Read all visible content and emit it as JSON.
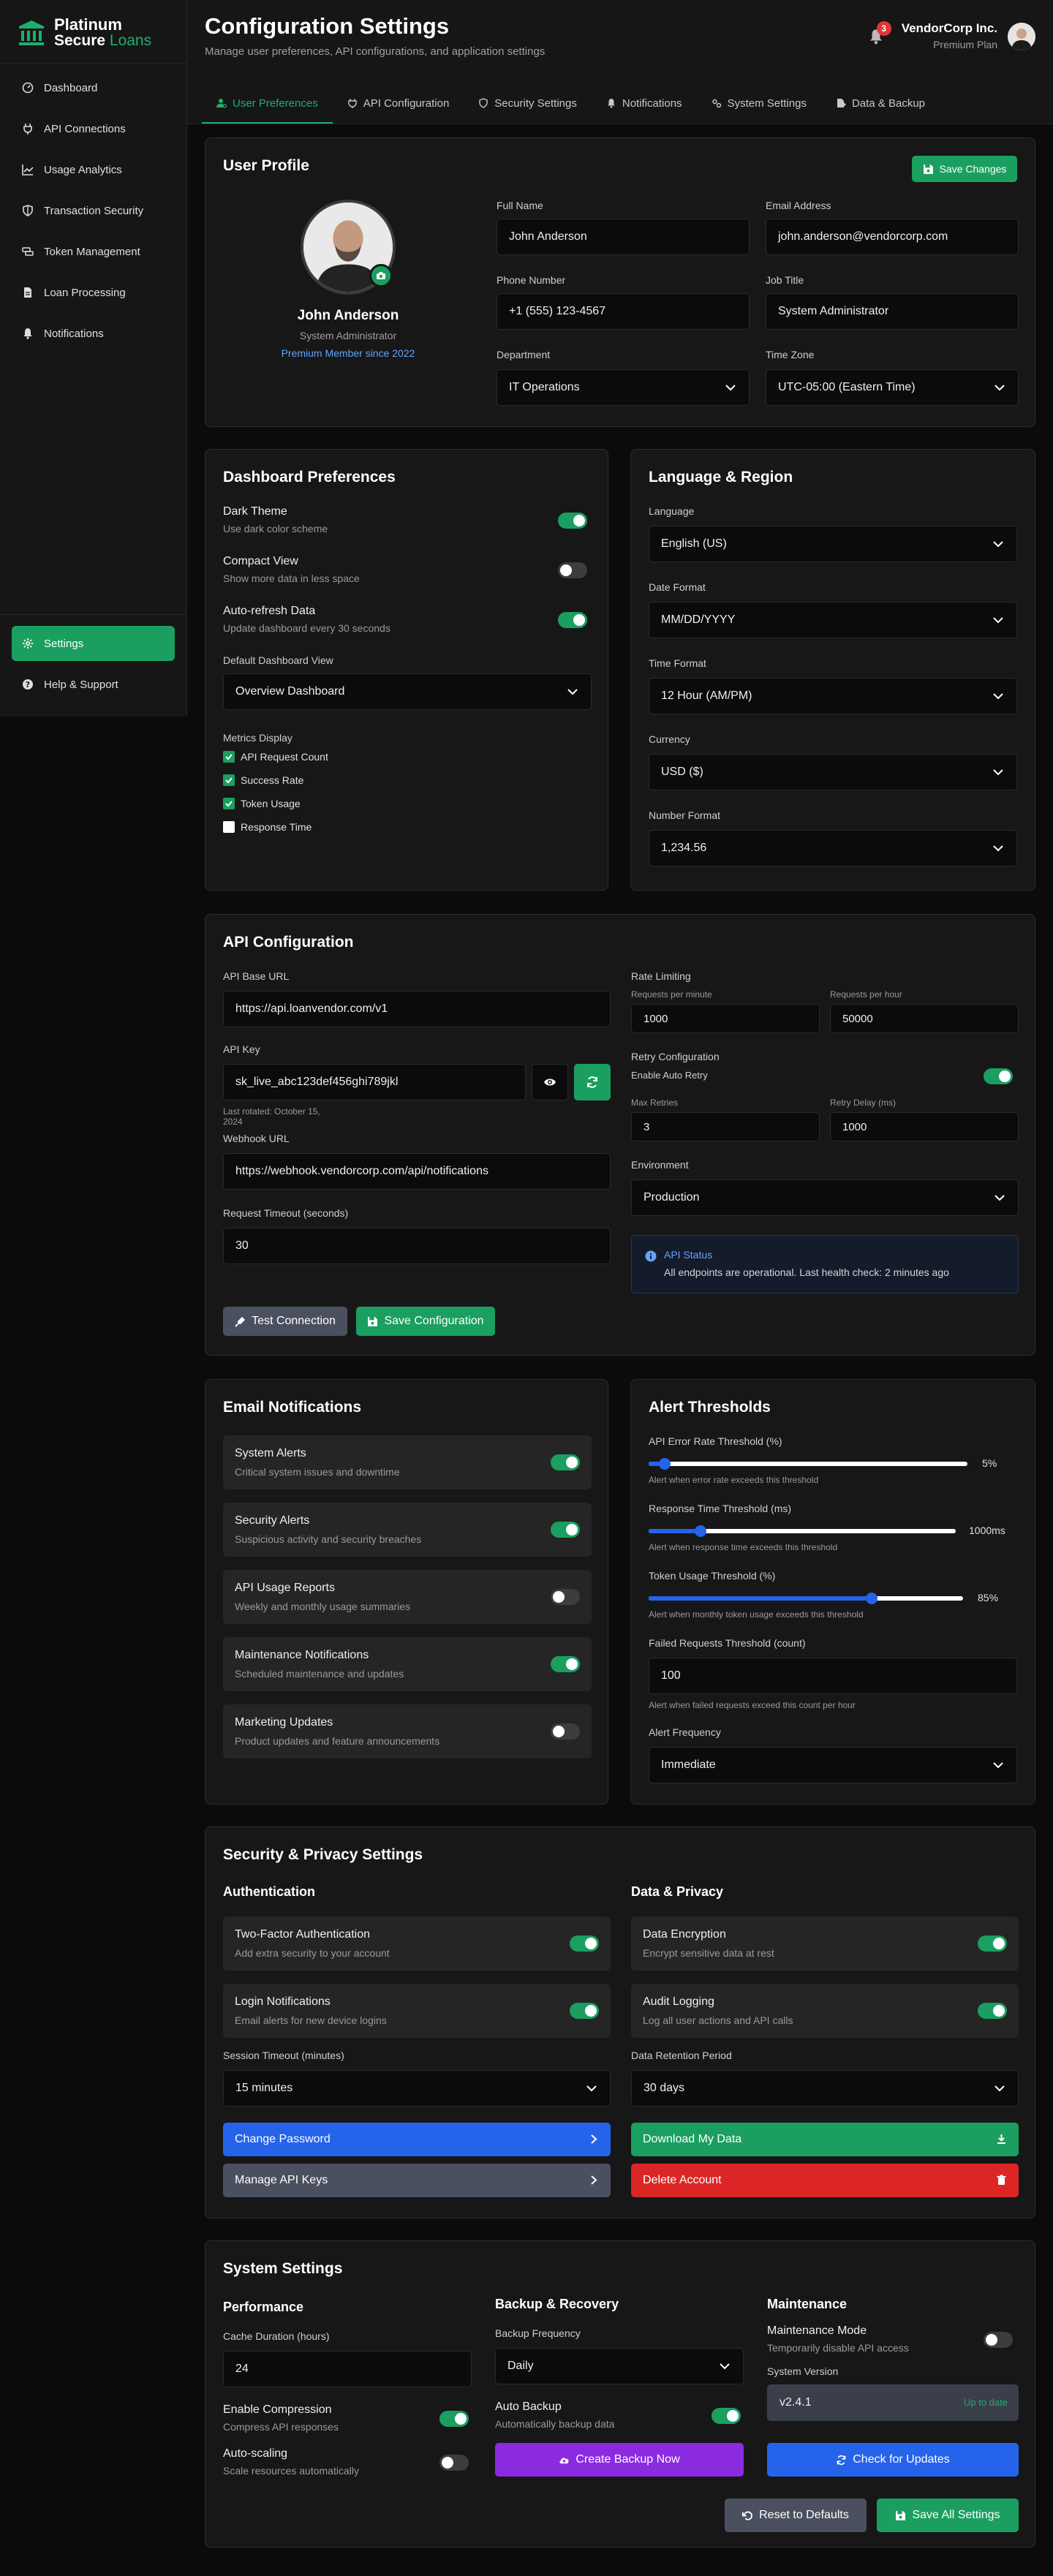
{
  "brand": {
    "line1": "Platinum",
    "line2a": "Secure",
    "line2b": "Loans"
  },
  "sidebar": {
    "items": [
      {
        "label": "Dashboard",
        "icon": "dashboard-icon"
      },
      {
        "label": "API Connections",
        "icon": "plug-icon"
      },
      {
        "label": "Usage Analytics",
        "icon": "chart-line-icon"
      },
      {
        "label": "Transaction Security",
        "icon": "shield-icon"
      },
      {
        "label": "Token Management",
        "icon": "coins-icon"
      },
      {
        "label": "Loan Processing",
        "icon": "file-icon"
      },
      {
        "label": "Notifications",
        "icon": "bell-icon"
      }
    ],
    "settings_label": "Settings",
    "help_label": "Help & Support"
  },
  "header": {
    "title": "Configuration Settings",
    "subtitle": "Manage user preferences, API configurations, and application settings",
    "notification_count": "3",
    "org_name": "VendorCorp Inc.",
    "org_plan": "Premium Plan"
  },
  "tabs": [
    "User Preferences",
    "API Configuration",
    "Security Settings",
    "Notifications",
    "System Settings",
    "Data & Backup"
  ],
  "profile": {
    "title": "User Profile",
    "save_label": "Save Changes",
    "name": "John Anderson",
    "role": "System Administrator",
    "member": "Premium Member since 2022",
    "full_name_label": "Full Name",
    "full_name": "John Anderson",
    "email_label": "Email Address",
    "email": "john.anderson@vendorcorp.com",
    "phone_label": "Phone Number",
    "phone": "+1 (555) 123-4567",
    "job_label": "Job Title",
    "job": "System Administrator",
    "dept_label": "Department",
    "dept": "IT Operations",
    "tz_label": "Time Zone",
    "tz": "UTC-05:00 (Eastern Time)"
  },
  "dashboard": {
    "title": "Dashboard Preferences",
    "dark_title": "Dark Theme",
    "dark_desc": "Use dark color scheme",
    "dark_on": true,
    "compact_title": "Compact View",
    "compact_desc": "Show more data in less space",
    "compact_on": false,
    "refresh_title": "Auto-refresh Data",
    "refresh_desc": "Update dashboard every 30 seconds",
    "refresh_on": true,
    "default_view_label": "Default Dashboard View",
    "default_view": "Overview Dashboard",
    "metrics_label": "Metrics Display",
    "metrics": [
      {
        "label": "API Request Count",
        "checked": true
      },
      {
        "label": "Success Rate",
        "checked": true
      },
      {
        "label": "Token Usage",
        "checked": true
      },
      {
        "label": "Response Time",
        "checked": false
      }
    ]
  },
  "language": {
    "title": "Language & Region",
    "language_label": "Language",
    "language": "English (US)",
    "date_label": "Date Format",
    "date": "MM/DD/YYYY",
    "time_label": "Time Format",
    "time": "12 Hour (AM/PM)",
    "currency_label": "Currency",
    "currency": "USD ($)",
    "number_label": "Number Format",
    "number": "1,234.56"
  },
  "api": {
    "title": "API Configuration",
    "base_url_label": "API Base URL",
    "base_url": "https://api.loanvendor.com/v1",
    "key_label": "API Key",
    "key": "sk_live_abc123def456ghi789jkl",
    "rotated_1": "Last rotated: October 15,",
    "rotated_2": "2024",
    "webhook_label": "Webhook URL",
    "webhook": "https://webhook.vendorcorp.com/api/notifications",
    "timeout_label": "Request Timeout (seconds)",
    "timeout": "30",
    "rate_label": "Rate Limiting",
    "rpm_label": "Requests per minute",
    "rpm": "1000",
    "rph_label": "Requests per hour",
    "rph": "50000",
    "retry_label": "Retry Configuration",
    "auto_retry_label": "Enable Auto Retry",
    "auto_retry_on": true,
    "max_retries_label": "Max Retries",
    "max_retries": "3",
    "retry_delay_label": "Retry Delay (ms)",
    "retry_delay": "1000",
    "env_label": "Environment",
    "env": "Production",
    "status_title": "API Status",
    "status_text": "All endpoints are operational. Last health check: 2 minutes ago",
    "test_label": "Test Connection",
    "save_label": "Save Configuration"
  },
  "email": {
    "title": "Email Notifications",
    "items": [
      {
        "title": "System Alerts",
        "desc": "Critical system issues and downtime",
        "on": true
      },
      {
        "title": "Security Alerts",
        "desc": "Suspicious activity and security breaches",
        "on": true
      },
      {
        "title": "API Usage Reports",
        "desc": "Weekly and monthly usage summaries",
        "on": false
      },
      {
        "title": "Maintenance Notifications",
        "desc": "Scheduled maintenance and updates",
        "on": true
      },
      {
        "title": "Marketing Updates",
        "desc": "Product updates and feature announcements",
        "on": false
      }
    ]
  },
  "alerts": {
    "title": "Alert Thresholds",
    "error_label": "API Error Rate Threshold (%)",
    "error_value": "5%",
    "error_level": 0.05,
    "error_help": "Alert when error rate exceeds this threshold",
    "response_label": "Response Time Threshold (ms)",
    "response_value": "1000ms",
    "response_level": 0.17,
    "response_help": "Alert when response time exceeds this threshold",
    "token_label": "Token Usage Threshold (%)",
    "token_value": "85%",
    "token_level": 0.71,
    "token_help": "Alert when monthly token usage exceeds this threshold",
    "failed_label": "Failed Requests Threshold (count)",
    "failed": "100",
    "failed_help": "Alert when failed requests exceed this count per hour",
    "freq_label": "Alert Frequency",
    "freq": "Immediate"
  },
  "security": {
    "title": "Security & Privacy Settings",
    "auth_title": "Authentication",
    "twofa_title": "Two-Factor Authentication",
    "twofa_desc": "Add extra security to your account",
    "twofa_on": true,
    "login_title": "Login Notifications",
    "login_desc": "Email alerts for new device logins",
    "login_on": true,
    "session_label": "Session Timeout (minutes)",
    "session": "15 minutes",
    "change_pw": "Change Password",
    "api_keys": "Manage API Keys",
    "privacy_title": "Data & Privacy",
    "enc_title": "Data Encryption",
    "enc_desc": "Encrypt sensitive data at rest",
    "enc_on": true,
    "audit_title": "Audit Logging",
    "audit_desc": "Log all user actions and API calls",
    "audit_on": true,
    "retention_label": "Data Retention Period",
    "retention": "30 days",
    "download": "Download My Data",
    "delete": "Delete Account"
  },
  "system": {
    "title": "System Settings",
    "perf_title": "Performance",
    "cache_label": "Cache Duration (hours)",
    "cache": "24",
    "compress_title": "Enable Compression",
    "compress_desc": "Compress API responses",
    "compress_on": true,
    "scale_title": "Auto-scaling",
    "scale_desc": "Scale resources automatically",
    "scale_on": false,
    "backup_title": "Backup & Recovery",
    "freq_label": "Backup Frequency",
    "freq": "Daily",
    "auto_title": "Auto Backup",
    "auto_desc": "Automatically backup data",
    "auto_on": true,
    "backup_now": "Create Backup Now",
    "maint_title": "Maintenance",
    "mode_title": "Maintenance Mode",
    "mode_desc": "Temporarily disable API access",
    "mode_on": false,
    "version_label": "System Version",
    "version": "v2.4.1",
    "version_status": "Up to date",
    "check": "Check for Updates",
    "reset": "Reset to Defaults",
    "save_all": "Save All Settings"
  },
  "colors": {
    "accent": "#1a9f60",
    "blue": "#2563eb",
    "danger": "#dc2626",
    "purple": "#8a2be2"
  }
}
